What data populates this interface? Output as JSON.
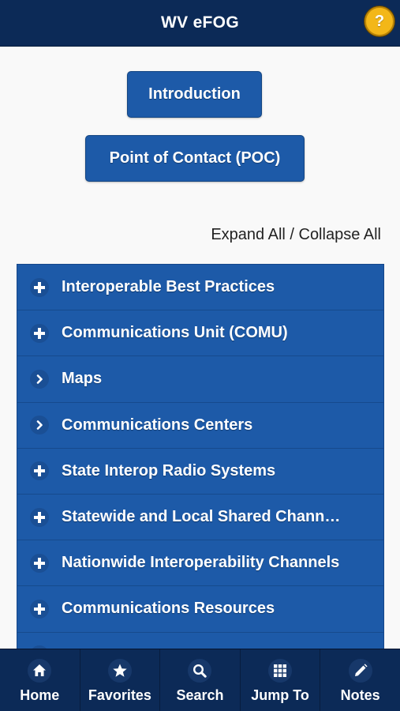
{
  "header": {
    "title": "WV eFOG",
    "help_label": "?"
  },
  "buttons": {
    "introduction": "Introduction",
    "poc": "Point of Contact (POC)"
  },
  "expand_collapse": "Expand All / Collapse All",
  "list_items": [
    {
      "label": "Interoperable Best Practices",
      "icon": "plus-icon"
    },
    {
      "label": "Communications Unit (COMU)",
      "icon": "plus-icon"
    },
    {
      "label": "Maps",
      "icon": "chevron-right-icon"
    },
    {
      "label": "Communications Centers",
      "icon": "chevron-right-icon"
    },
    {
      "label": "State Interop Radio Systems",
      "icon": "plus-icon"
    },
    {
      "label": "Statewide and Local Shared Chann…",
      "icon": "plus-icon"
    },
    {
      "label": "Nationwide Interoperability Channels",
      "icon": "plus-icon"
    },
    {
      "label": "Communications Resources",
      "icon": "plus-icon"
    }
  ],
  "tabs": [
    {
      "label": "Home",
      "icon": "home-icon"
    },
    {
      "label": "Favorites",
      "icon": "star-icon"
    },
    {
      "label": "Search",
      "icon": "search-icon"
    },
    {
      "label": "Jump To",
      "icon": "grid-icon"
    },
    {
      "label": "Notes",
      "icon": "pencil-icon"
    }
  ],
  "colors": {
    "header_bg": "#0c2a57",
    "accent": "#1d5aa8",
    "help_button": "#f3b718"
  }
}
